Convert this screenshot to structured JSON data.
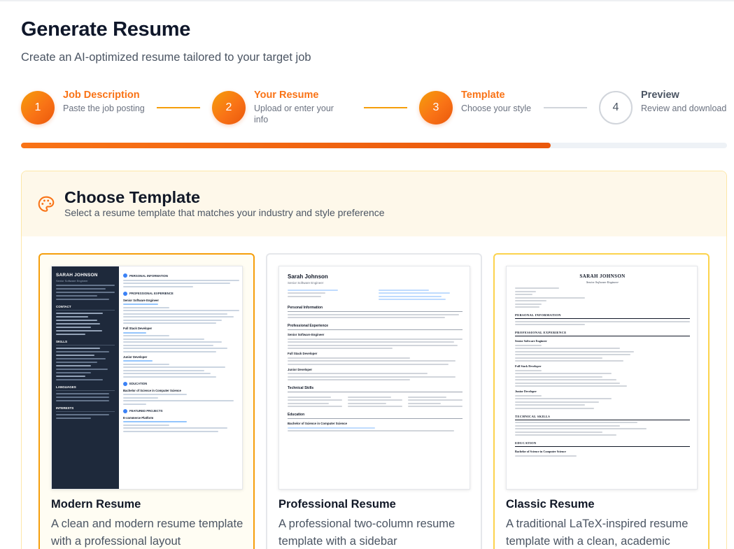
{
  "page": {
    "title": "Generate Resume",
    "subtitle": "Create an AI-optimized resume tailored to your target job"
  },
  "steps": [
    {
      "number": "1",
      "title": "Job Description",
      "description": "Paste the job posting",
      "state": "complete"
    },
    {
      "number": "2",
      "title": "Your Resume",
      "description": "Upload or enter your info",
      "state": "complete"
    },
    {
      "number": "3",
      "title": "Template",
      "description": "Choose your style",
      "state": "active"
    },
    {
      "number": "4",
      "title": "Preview",
      "description": "Review and download",
      "state": "inactive"
    }
  ],
  "progress": {
    "value": 0.75
  },
  "section": {
    "icon": "palette-icon",
    "title": "Choose Template",
    "subtitle": "Select a resume template that matches your industry and style preference"
  },
  "templates": [
    {
      "name": "Modern Resume",
      "description": "A clean and modern resume template with a professional layout",
      "selected": true,
      "preview": {
        "name": "SARAH JOHNSON",
        "role": "Senior Software Engineer",
        "sections": [
          "CONTACT",
          "SKILLS",
          "LANGUAGES",
          "INTERESTS",
          "PERSONAL INFORMATION",
          "PROFESSIONAL EXPERIENCE",
          "EDUCATION",
          "FEATURED PROJECTS"
        ],
        "jobs": [
          "Senior Software Engineer",
          "Full Stack Developer",
          "Junior Developer"
        ],
        "degree": "Bachelor of Science in Computer Science",
        "project": "E-commerce Platform"
      }
    },
    {
      "name": "Professional Resume",
      "description": "A professional two-column resume template with a sidebar",
      "selected": false,
      "preview": {
        "name": "Sarah Johnson",
        "role": "Senior Software Engineer",
        "sections": [
          "Personal Information",
          "Professional Experience",
          "Technical Skills",
          "Education"
        ],
        "jobs": [
          "Senior Software Engineer",
          "Full Stack Developer",
          "Junior Developer"
        ],
        "degree": "Bachelor of Science in Computer Science"
      }
    },
    {
      "name": "Classic Resume",
      "description": "A traditional LaTeX-inspired resume template with a clean, academic",
      "selected": false,
      "preview": {
        "name": "SARAH JOHNSON",
        "role": "Senior Software Engineer",
        "sections": [
          "PERSONAL INFORMATION",
          "PROFESSIONAL EXPERIENCE",
          "TECHNICAL SKILLS",
          "EDUCATION"
        ],
        "jobs": [
          "Senior Software Engineer",
          "Full Stack Developer",
          "Junior Developer"
        ],
        "degree": "Bachelor of Science in Computer Science"
      }
    }
  ],
  "colors": {
    "accent": "#f97316",
    "accent_light": "#f59e0b",
    "panel_bg": "#fef8ea",
    "sidebar_dark": "#1e293b"
  }
}
